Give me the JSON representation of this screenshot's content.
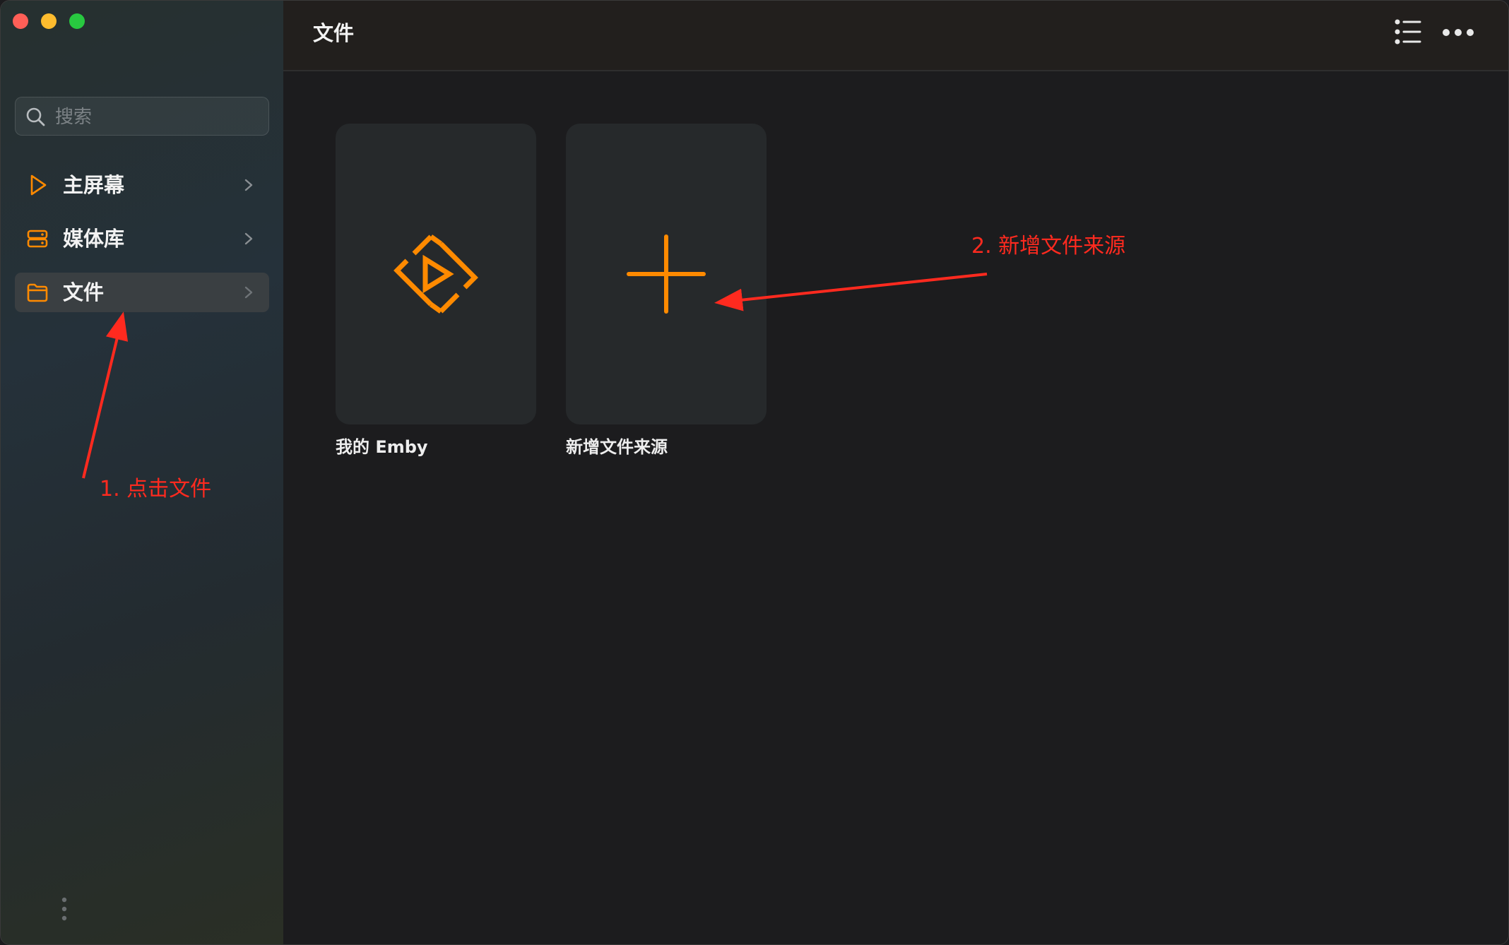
{
  "sidebar": {
    "search": {
      "placeholder": "搜索",
      "value": ""
    },
    "items": [
      {
        "label": "主屏幕",
        "icon": "play-icon"
      },
      {
        "label": "媒体库",
        "icon": "server-icon"
      },
      {
        "label": "文件",
        "icon": "folder-icon",
        "active": true
      }
    ]
  },
  "header": {
    "title": "文件"
  },
  "cards": [
    {
      "label": "我的 Emby",
      "icon": "emby-logo-icon"
    },
    {
      "label": "新增文件来源",
      "icon": "plus-icon"
    }
  ],
  "annotations": [
    {
      "text": "1. 点击文件"
    },
    {
      "text": "2. 新增文件来源"
    }
  ],
  "colors": {
    "accent": "#ff8a00",
    "annotation": "#ff2a1f",
    "sidebar_active": "#3a3f42",
    "card_bg": "#26292b",
    "main_bg": "#1c1c1e"
  }
}
